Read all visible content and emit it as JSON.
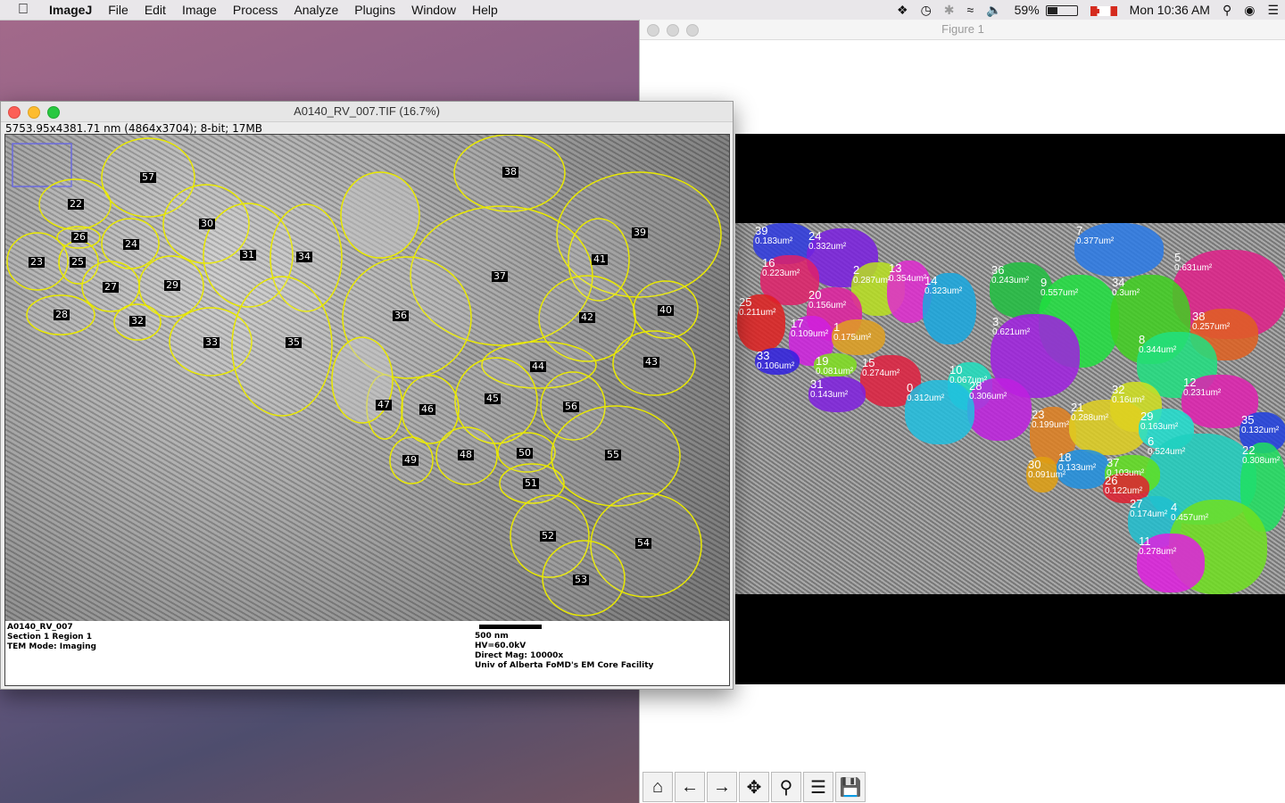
{
  "menubar": {
    "app_name": "ImageJ",
    "items": [
      "File",
      "Edit",
      "Image",
      "Process",
      "Analyze",
      "Plugins",
      "Window",
      "Help"
    ],
    "battery": "59%",
    "clock": "Mon 10:36 AM",
    "status_icons": [
      "dropbox-icon",
      "time-machine-icon",
      "bluetooth-icon",
      "wifi-icon",
      "volume-icon",
      "battery-icon",
      "flag-icon",
      "search-icon",
      "siri-icon",
      "menu-icon"
    ]
  },
  "imagej": {
    "title": "A0140_RV_007.TIF (16.7%)",
    "info": "5753.95x4381.71 nm (4864x3704); 8-bit; 17MB",
    "labels": [
      "57",
      "38",
      "22",
      "30",
      "39",
      "26",
      "24",
      "31",
      "34",
      "23",
      "25",
      "41",
      "27",
      "29",
      "37",
      "28",
      "32",
      "36",
      "42",
      "40",
      "33",
      "35",
      "43",
      "44",
      "45",
      "47",
      "46",
      "56",
      "49",
      "48",
      "50",
      "55",
      "51",
      "52",
      "54",
      "53"
    ],
    "caption_left": [
      "A0140_RV_007",
      "Section 1 Region 1",
      "TEM Mode: Imaging"
    ],
    "caption_right": [
      "500 nm",
      "HV=60.0kV",
      "Direct Mag: 10000x",
      "Univ of Alberta FoMD's EM Core Facility"
    ]
  },
  "figure": {
    "title": "Figure 1",
    "segments": [
      {
        "id": "39",
        "area": "0.183um²",
        "color": "#2e3ae0"
      },
      {
        "id": "24",
        "area": "0.332um²",
        "color": "#7a1fe0"
      },
      {
        "id": "7",
        "area": "0.377um²",
        "color": "#2a7ae8"
      },
      {
        "id": "5",
        "area": "0.631um²",
        "color": "#e0208a"
      },
      {
        "id": "16",
        "area": "0.223um²",
        "color": "#e0206a"
      },
      {
        "id": "2",
        "area": "0.287um²",
        "color": "#b8e020"
      },
      {
        "id": "13",
        "area": "0.354um²",
        "color": "#e02ad0"
      },
      {
        "id": "14",
        "area": "0.323um²",
        "color": "#18a8e0"
      },
      {
        "id": "36",
        "area": "0.243um²",
        "color": "#20c040"
      },
      {
        "id": "9",
        "area": "0.557um²",
        "color": "#20e040"
      },
      {
        "id": "34",
        "area": "0.3um²",
        "color": "#40d020"
      },
      {
        "id": "25",
        "area": "0.211um²",
        "color": "#e02020"
      },
      {
        "id": "20",
        "area": "0.156um²",
        "color": "#e020a0"
      },
      {
        "id": "38",
        "area": "0.257um²",
        "color": "#e06020"
      },
      {
        "id": "17",
        "area": "0.109um²",
        "color": "#d020e0"
      },
      {
        "id": "1",
        "area": "0.175um²",
        "color": "#e0a020"
      },
      {
        "id": "3",
        "area": "0.621um²",
        "color": "#a020e0"
      },
      {
        "id": "8",
        "area": "0.344um²",
        "color": "#20e080"
      },
      {
        "id": "33",
        "area": "0.106um²",
        "color": "#3020e0"
      },
      {
        "id": "19",
        "area": "0.081um²",
        "color": "#80e020"
      },
      {
        "id": "15",
        "area": "0.274um²",
        "color": "#e02040"
      },
      {
        "id": "10",
        "area": "0.067um²",
        "color": "#20e0c0"
      },
      {
        "id": "28",
        "area": "0.306um²",
        "color": "#c020e0"
      },
      {
        "id": "12",
        "area": "0.231um²",
        "color": "#e020b0"
      },
      {
        "id": "31",
        "area": "0.143um²",
        "color": "#8020e0"
      },
      {
        "id": "0",
        "area": "0.312um²",
        "color": "#20c0e0"
      },
      {
        "id": "32",
        "area": "0.16um²",
        "color": "#d0e020"
      },
      {
        "id": "23",
        "area": "0.199um²",
        "color": "#e08020"
      },
      {
        "id": "21",
        "area": "0.288um²",
        "color": "#e0d020"
      },
      {
        "id": "29",
        "area": "0.163um²",
        "color": "#20e0d0"
      },
      {
        "id": "35",
        "area": "0.132um²",
        "color": "#2040e0"
      },
      {
        "id": "6",
        "area": "0.524um²",
        "color": "#20d0c0"
      },
      {
        "id": "22",
        "area": "0.308um²",
        "color": "#20e060"
      },
      {
        "id": "30",
        "area": "0.091um²",
        "color": "#e0a010"
      },
      {
        "id": "18",
        "area": "0.133um²",
        "color": "#2090e0"
      },
      {
        "id": "37",
        "area": "0.103um²",
        "color": "#60e020"
      },
      {
        "id": "26",
        "area": "0.122um²",
        "color": "#e02030"
      },
      {
        "id": "27",
        "area": "0.174um²",
        "color": "#20c0d0"
      },
      {
        "id": "4",
        "area": "0.457um²",
        "color": "#70e020"
      },
      {
        "id": "11",
        "area": "0.278um²",
        "color": "#e020e0"
      }
    ],
    "toolbar": [
      "home-icon",
      "back-icon",
      "forward-icon",
      "pan-icon",
      "zoom-icon",
      "configure-icon",
      "save-icon"
    ]
  }
}
